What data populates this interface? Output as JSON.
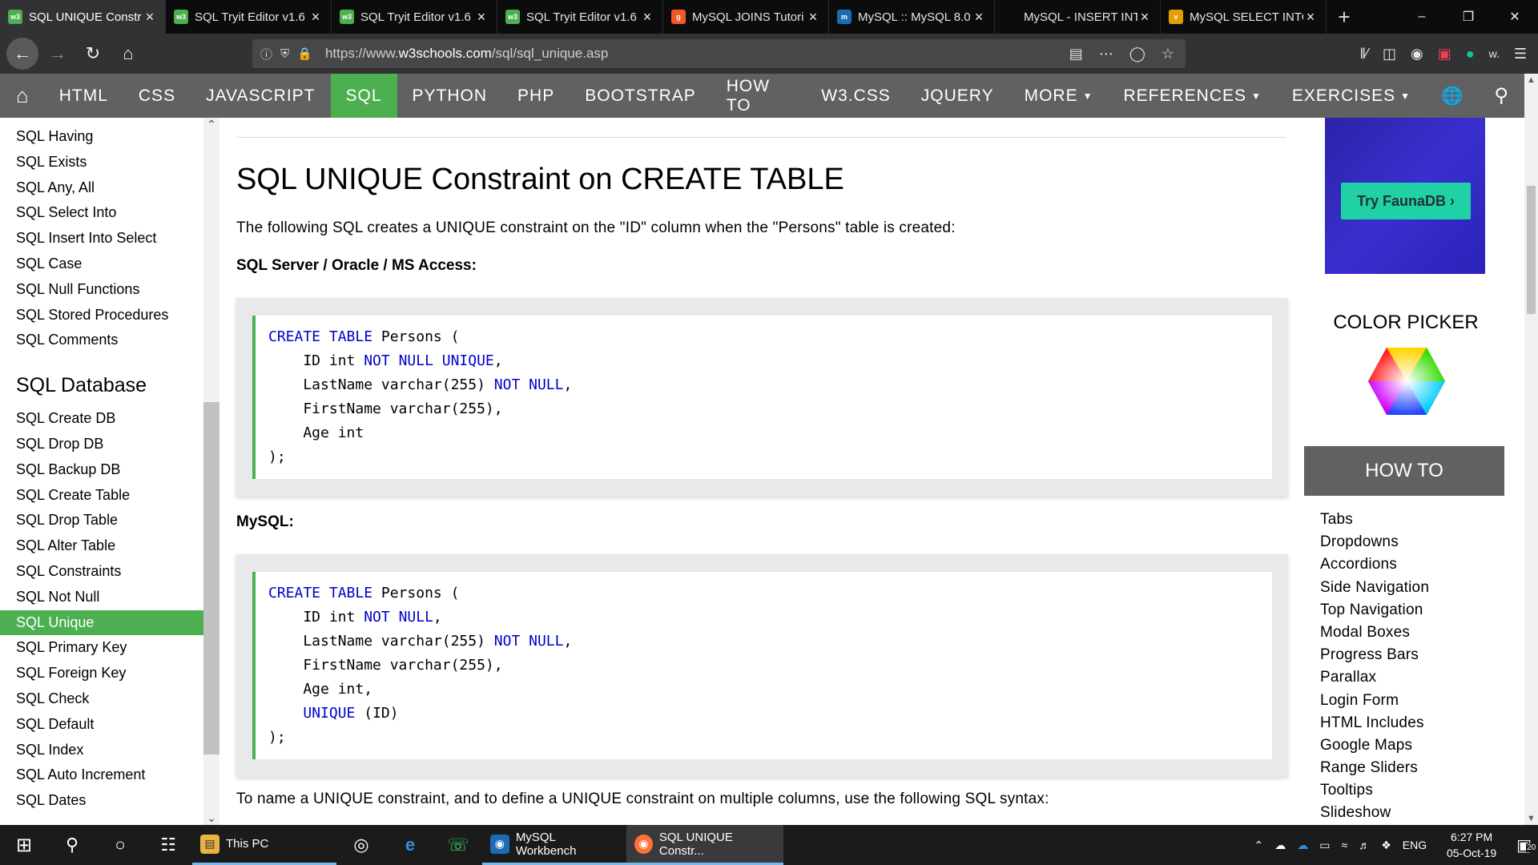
{
  "browser": {
    "tabs": [
      {
        "title": "SQL UNIQUE Constr",
        "favicon": "w3",
        "color": "#4CAF50",
        "active": true
      },
      {
        "title": "SQL Tryit Editor v1.6",
        "favicon": "w3",
        "color": "#4CAF50",
        "active": false
      },
      {
        "title": "SQL Tryit Editor v1.6",
        "favicon": "w3",
        "color": "#4CAF50",
        "active": false
      },
      {
        "title": "SQL Tryit Editor v1.6",
        "favicon": "w3",
        "color": "#4CAF50",
        "active": false
      },
      {
        "title": "MySQL JOINS Tutori",
        "favicon": "g",
        "color": "#f05a28",
        "active": false
      },
      {
        "title": "MySQL :: MySQL 8.0",
        "favicon": "m",
        "color": "#1d6bb5",
        "active": false
      },
      {
        "title": "MySQL - INSERT INT",
        "favicon": "",
        "color": "#0c0c0d",
        "active": false
      },
      {
        "title": "MySQL SELECT INTO",
        "favicon": "v",
        "color": "#e2a100",
        "active": false
      }
    ],
    "new_tab_icon": "plus-icon",
    "url_prefix": "https://www.",
    "url_domain": "w3schools.com",
    "url_path": "/sql/sql_unique.asp"
  },
  "w3nav": {
    "home_icon": "home-icon",
    "items": [
      "HTML",
      "CSS",
      "JAVASCRIPT",
      "SQL",
      "PYTHON",
      "PHP",
      "BOOTSTRAP",
      "HOW TO",
      "W3.CSS",
      "JQUERY",
      "MORE"
    ],
    "active_item": "SQL",
    "right_items": [
      "REFERENCES",
      "EXERCISES"
    ],
    "accent": "#4CAF50",
    "bar_color": "#616161"
  },
  "sidebar": {
    "top_links": [
      "SQL Having",
      "SQL Exists",
      "SQL Any, All",
      "SQL Select Into",
      "SQL Insert Into Select",
      "SQL Case",
      "SQL Null Functions",
      "SQL Stored Procedures",
      "SQL Comments"
    ],
    "section_heading": "SQL Database",
    "db_links": [
      "SQL Create DB",
      "SQL Drop DB",
      "SQL Backup DB",
      "SQL Create Table",
      "SQL Drop Table",
      "SQL Alter Table",
      "SQL Constraints",
      "SQL Not Null",
      "SQL Unique",
      "SQL Primary Key",
      "SQL Foreign Key",
      "SQL Check",
      "SQL Default",
      "SQL Index",
      "SQL Auto Increment",
      "SQL Dates"
    ],
    "active_link": "SQL Unique"
  },
  "main": {
    "heading": "SQL UNIQUE Constraint on CREATE TABLE",
    "intro": "The following SQL creates a UNIQUE constraint on the \"ID\" column when the \"Persons\" table is created:",
    "label1": "SQL Server / Oracle / MS Access:",
    "code1": [
      [
        {
          "t": "CREATE TABLE",
          "k": true
        },
        {
          "t": " Persons (",
          "k": false
        }
      ],
      [
        {
          "t": "    ID int ",
          "k": false
        },
        {
          "t": "NOT NULL UNIQUE",
          "k": true
        },
        {
          "t": ",",
          "k": false
        }
      ],
      [
        {
          "t": "    LastName varchar(255) ",
          "k": false
        },
        {
          "t": "NOT NULL",
          "k": true
        },
        {
          "t": ",",
          "k": false
        }
      ],
      [
        {
          "t": "    FirstName varchar(255),",
          "k": false
        }
      ],
      [
        {
          "t": "    Age int",
          "k": false
        }
      ],
      [
        {
          "t": ");",
          "k": false
        }
      ]
    ],
    "label2": "MySQL:",
    "code2": [
      [
        {
          "t": "CREATE TABLE",
          "k": true
        },
        {
          "t": " Persons (",
          "k": false
        }
      ],
      [
        {
          "t": "    ID int ",
          "k": false
        },
        {
          "t": "NOT NULL",
          "k": true
        },
        {
          "t": ",",
          "k": false
        }
      ],
      [
        {
          "t": "    LastName varchar(255) ",
          "k": false
        },
        {
          "t": "NOT NULL",
          "k": true
        },
        {
          "t": ",",
          "k": false
        }
      ],
      [
        {
          "t": "    FirstName varchar(255),",
          "k": false
        }
      ],
      [
        {
          "t": "    Age int,",
          "k": false
        }
      ],
      [
        {
          "t": "    ",
          "k": false
        },
        {
          "t": "UNIQUE",
          "k": true
        },
        {
          "t": " (ID)",
          "k": false
        }
      ],
      [
        {
          "t": ");",
          "k": false
        }
      ]
    ],
    "outro": "To name a UNIQUE constraint, and to define a UNIQUE constraint on multiple columns, use the following SQL syntax:"
  },
  "right": {
    "ad_button": "Try FaunaDB ›",
    "color_picker_title": "COLOR PICKER",
    "howto_title": "HOW TO",
    "howto_links": [
      "Tabs",
      "Dropdowns",
      "Accordions",
      "Side Navigation",
      "Top Navigation",
      "Modal Boxes",
      "Progress Bars",
      "Parallax",
      "Login Form",
      "HTML Includes",
      "Google Maps",
      "Range Sliders",
      "Tooltips",
      "Slideshow"
    ]
  },
  "taskbar": {
    "apps": [
      {
        "label": "This PC",
        "state": "open"
      },
      {
        "label": "MySQL Workbench",
        "state": "open"
      },
      {
        "label": "SQL UNIQUE Constr...",
        "state": "active"
      }
    ],
    "lang": "ENG",
    "time": "6:27 PM",
    "date": "05-Oct-19",
    "notif_count": "20"
  }
}
